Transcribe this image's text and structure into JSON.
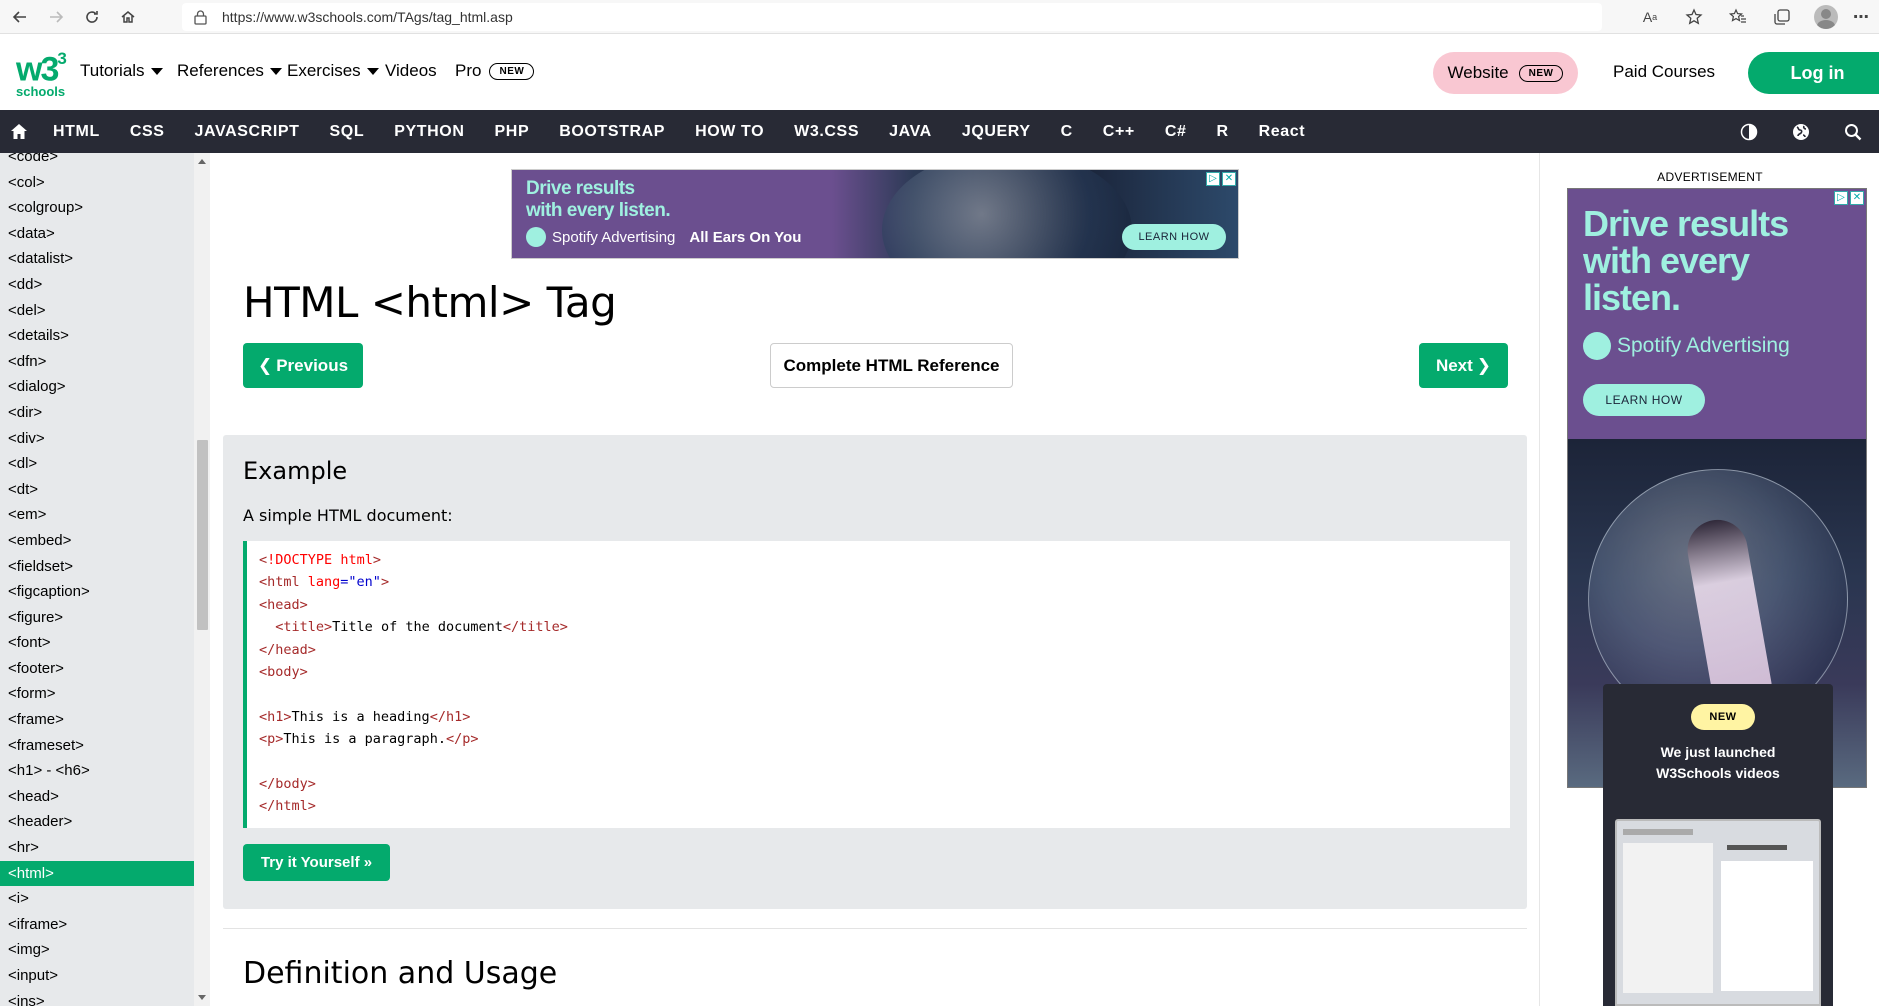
{
  "browser": {
    "url": "https://www.w3schools.com/TAgs/tag_html.asp"
  },
  "header": {
    "logo_text": "w3",
    "logo_sup": "3",
    "logo_sub": "schools",
    "nav": [
      {
        "label": "Tutorials",
        "has_caret": true
      },
      {
        "label": "References",
        "has_caret": true
      },
      {
        "label": "Exercises",
        "has_caret": true
      },
      {
        "label": "Videos",
        "has_caret": false
      }
    ],
    "pro_label": "Pro",
    "pro_badge": "NEW",
    "website_label": "Website",
    "website_badge": "NEW",
    "paid_courses": "Paid Courses",
    "login": "Log in",
    "accent_color": "#04AA6D"
  },
  "subnav": {
    "items": [
      "HTML",
      "CSS",
      "JAVASCRIPT",
      "SQL",
      "PYTHON",
      "PHP",
      "BOOTSTRAP",
      "HOW TO",
      "W3.CSS",
      "JAVA",
      "JQUERY",
      "C",
      "C++",
      "C#",
      "R",
      "React"
    ],
    "icons": [
      "home-icon",
      "contrast-icon",
      "globe-icon",
      "search-icon"
    ]
  },
  "sidebar": {
    "items": [
      "<code>",
      "<col>",
      "<colgroup>",
      "<data>",
      "<datalist>",
      "<dd>",
      "<del>",
      "<details>",
      "<dfn>",
      "<dialog>",
      "<dir>",
      "<div>",
      "<dl>",
      "<dt>",
      "<em>",
      "<embed>",
      "<fieldset>",
      "<figcaption>",
      "<figure>",
      "<font>",
      "<footer>",
      "<form>",
      "<frame>",
      "<frameset>",
      "<h1> - <h6>",
      "<head>",
      "<header>",
      "<hr>",
      "<html>",
      "<i>",
      "<iframe>",
      "<img>",
      "<input>",
      "<ins>"
    ],
    "active": "<html>"
  },
  "main": {
    "ad_top": {
      "headline_1": "Drive results",
      "headline_2": "with every listen.",
      "brand": "Spotify Advertising",
      "tagline": "All Ears On You",
      "cta": "LEARN HOW"
    },
    "title": "HTML <html> Tag",
    "prev_label": "Previous",
    "next_label": "Next",
    "ref_label": "Complete HTML Reference",
    "example": {
      "heading": "Example",
      "description": "A simple HTML document:",
      "try_label": "Try it Yourself »"
    },
    "definition_heading": "Definition and Usage"
  },
  "right": {
    "ad_label": "ADVERTISEMENT",
    "ad": {
      "headline_1": "Drive results",
      "headline_2": "with every",
      "headline_3": "listen.",
      "brand": "Spotify Advertising",
      "cta": "LEARN HOW"
    },
    "promo": {
      "badge": "NEW",
      "line1": "We just launched",
      "line2": "W3Schools videos"
    }
  }
}
